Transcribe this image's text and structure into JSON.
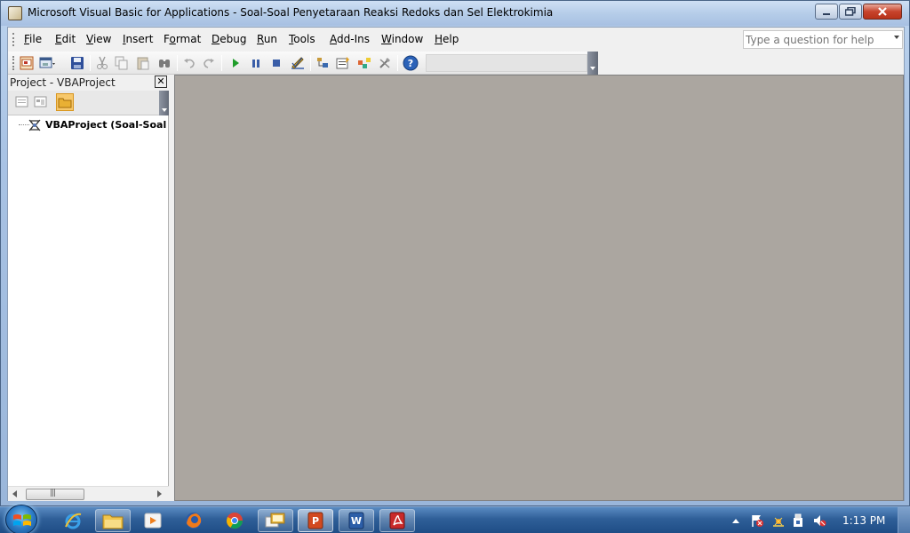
{
  "window": {
    "title": "Microsoft Visual Basic for Applications - Soal-Soal Penyetaraan Reaksi Redoks dan Sel Elektrokimia"
  },
  "menu": {
    "items": [
      {
        "label": "File",
        "u": "F",
        "rest": "ile"
      },
      {
        "label": "Edit",
        "u": "E",
        "rest": "dit"
      },
      {
        "label": "View",
        "u": "V",
        "rest": "iew"
      },
      {
        "label": "Insert",
        "u": "I",
        "rest": "nsert"
      },
      {
        "label": "Format",
        "u": "F",
        "rest": "ormat",
        "u_index": 1,
        "pre": "F",
        "under": "o",
        "post": "rmat"
      },
      {
        "label": "Debug",
        "u": "D",
        "rest": "ebug"
      },
      {
        "label": "Run",
        "u": "R",
        "rest": "un"
      },
      {
        "label": "Tools",
        "u": "T",
        "rest": "ools"
      },
      {
        "label": "Add-Ins",
        "u": "A",
        "rest": "dd-Ins"
      },
      {
        "label": "Window",
        "u": "W",
        "rest": "indow"
      },
      {
        "label": "Help",
        "u": "H",
        "rest": "elp"
      }
    ],
    "help_placeholder": "Type a question for help"
  },
  "toolbar": {
    "icons": [
      "view-excel-icon",
      "insert-userform-icon",
      "save-icon",
      "cut-icon",
      "copy-icon",
      "paste-icon",
      "find-icon",
      "undo-icon",
      "redo-icon",
      "run-icon",
      "break-icon",
      "reset-icon",
      "design-mode-icon",
      "project-explorer-icon",
      "properties-window-icon",
      "object-browser-icon",
      "toolbox-icon",
      "help-icon"
    ]
  },
  "project_panel": {
    "title": "Project - VBAProject",
    "close_label": "✕",
    "tree": [
      {
        "label": "VBAProject (Soal-Soal Penyetaraan Reaksi Redoks dan Sel Elektrokimia)"
      }
    ]
  },
  "taskbar": {
    "apps": [
      "internet-explorer",
      "windows-explorer",
      "media-player",
      "firefox",
      "chrome",
      "powerpoint-slides",
      "powerpoint",
      "word",
      "acrobat"
    ],
    "clock": "1:13 PM"
  },
  "colors": {
    "workspace": "#aba6a0",
    "titlebar": "#b6cde9",
    "taskbar": "#2f5f98"
  }
}
